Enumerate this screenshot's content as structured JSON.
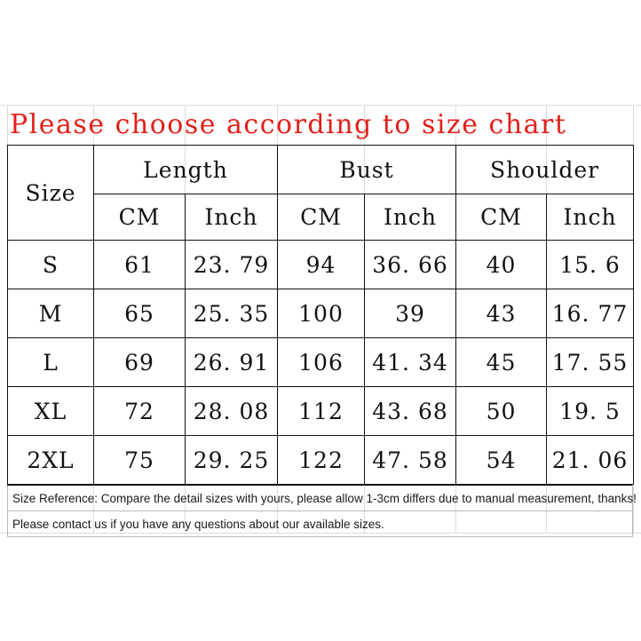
{
  "title": {
    "text": "Please choose according to size chart",
    "color": "#e3201a"
  },
  "table": {
    "size_header": "Size",
    "groups": [
      {
        "label": "Length"
      },
      {
        "label": "Bust"
      },
      {
        "label": "Shoulder"
      }
    ],
    "unit_headers": [
      "CM",
      "Inch",
      "CM",
      "Inch",
      "CM",
      "Inch"
    ],
    "rows": [
      {
        "size": "S",
        "length_cm": "61",
        "length_inch": "23. 79",
        "bust_cm": "94",
        "bust_inch": "36. 66",
        "shoulder_cm": "40",
        "shoulder_inch": "15. 6"
      },
      {
        "size": "M",
        "length_cm": "65",
        "length_inch": "25. 35",
        "bust_cm": "100",
        "bust_inch": "39",
        "shoulder_cm": "43",
        "shoulder_inch": "16. 77"
      },
      {
        "size": "L",
        "length_cm": "69",
        "length_inch": "26. 91",
        "bust_cm": "106",
        "bust_inch": "41. 34",
        "shoulder_cm": "45",
        "shoulder_inch": "17. 55"
      },
      {
        "size": "XL",
        "length_cm": "72",
        "length_inch": "28. 08",
        "bust_cm": "112",
        "bust_inch": "43. 68",
        "shoulder_cm": "50",
        "shoulder_inch": "19. 5"
      },
      {
        "size": "2XL",
        "length_cm": "75",
        "length_inch": "29. 25",
        "bust_cm": "122",
        "bust_inch": "47. 58",
        "shoulder_cm": "54",
        "shoulder_inch": "21. 06"
      }
    ]
  },
  "notes": {
    "reference": "Size Reference: Compare the detail sizes with yours, please allow 1-3cm differs due to manual measurement, thanks!",
    "contact": "Please contact us if you have any questions about our available sizes."
  }
}
